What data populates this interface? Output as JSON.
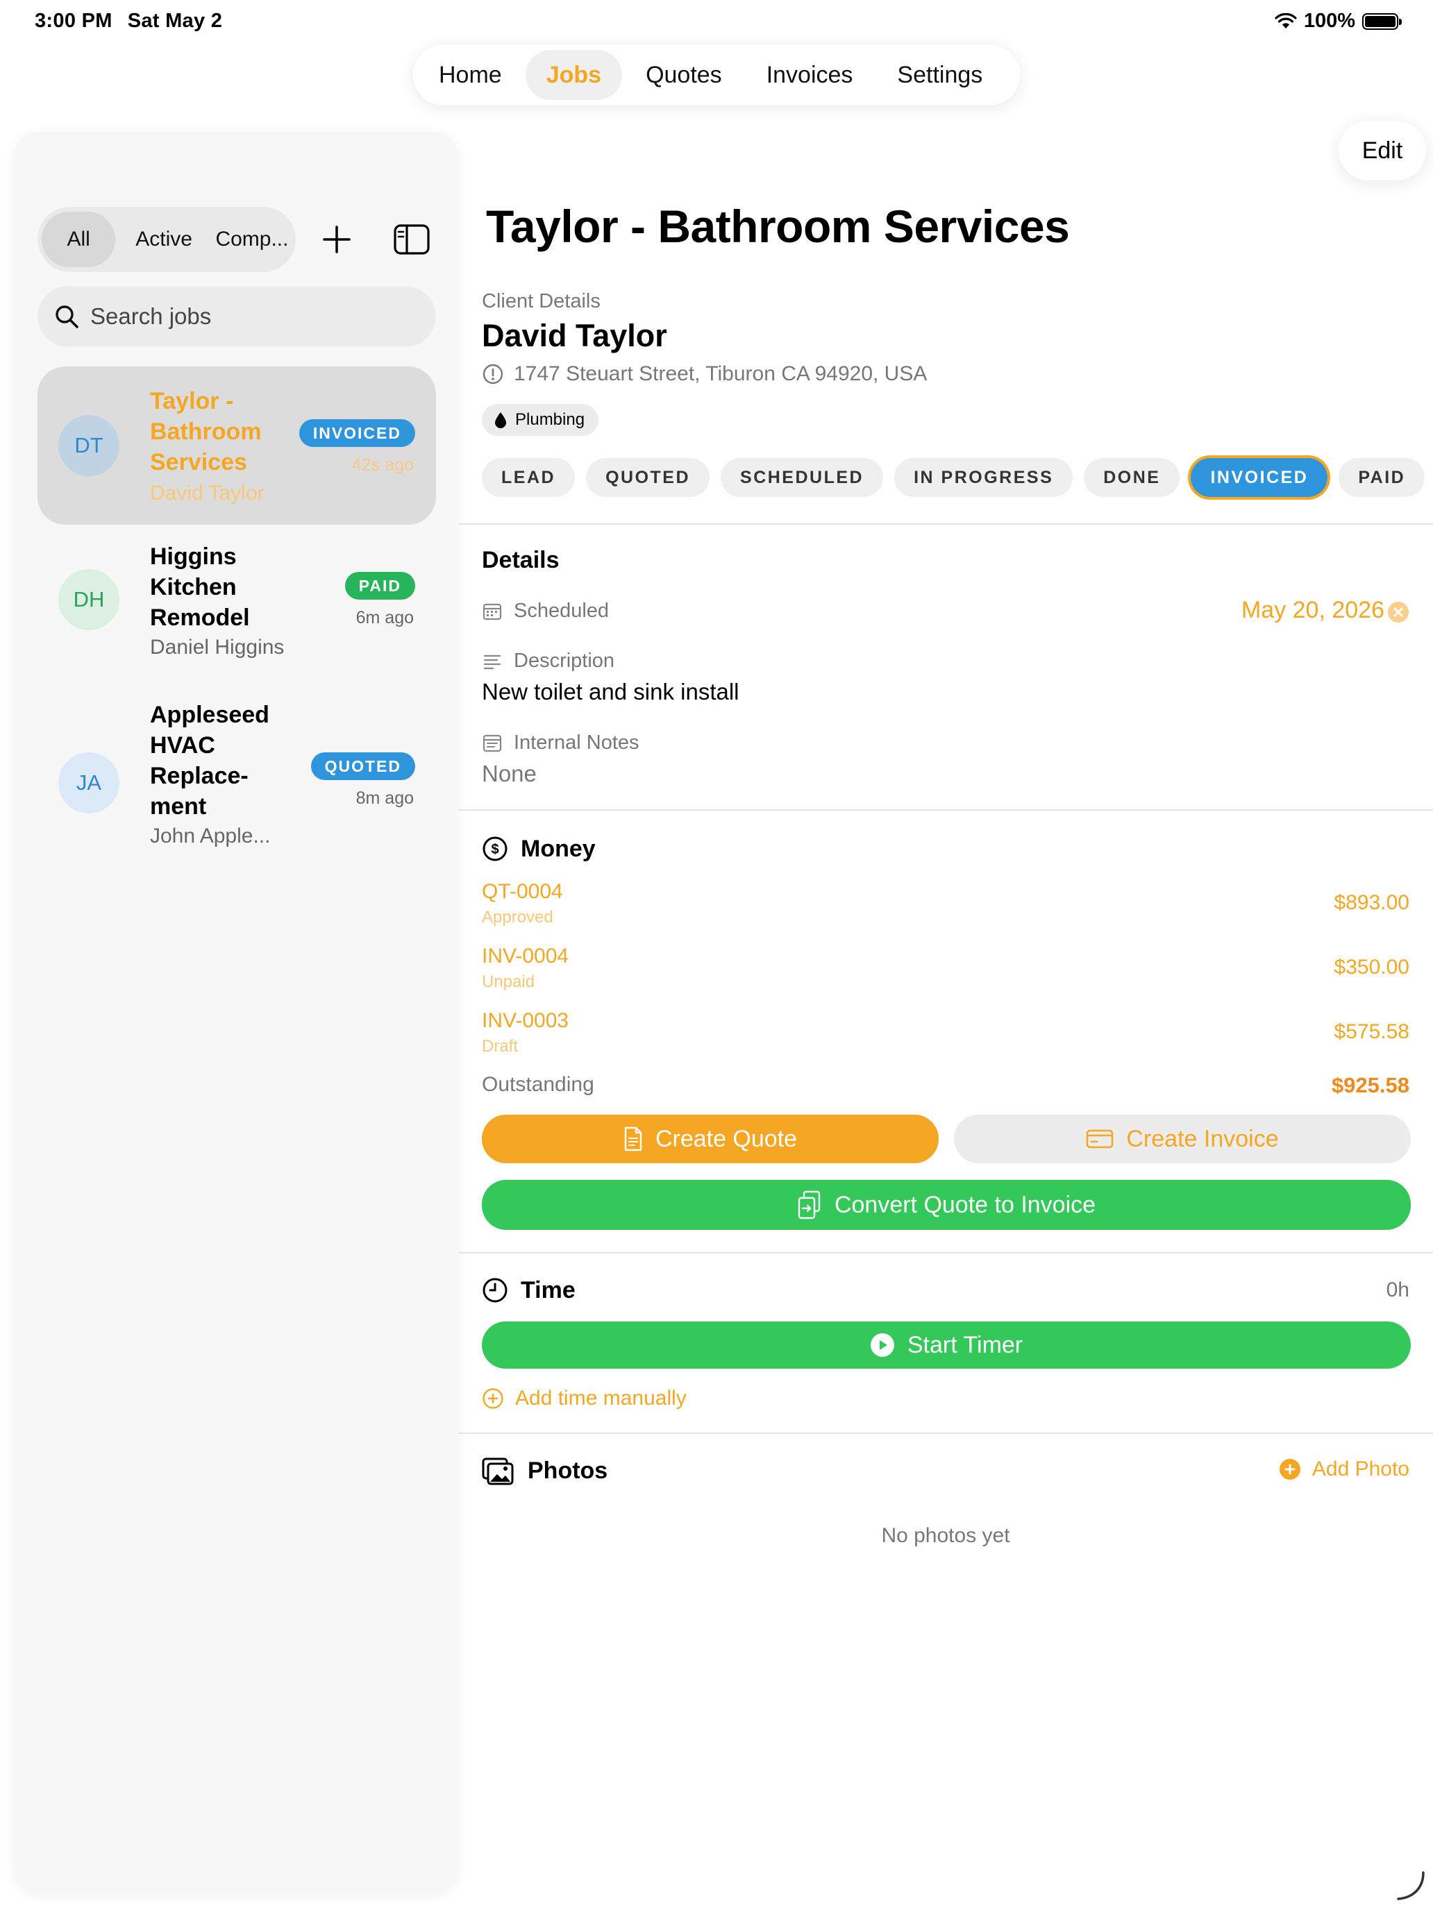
{
  "status_bar": {
    "time": "3:00 PM",
    "date": "Sat May 2",
    "battery": "100%"
  },
  "nav": {
    "tabs": [
      "Home",
      "Jobs",
      "Quotes",
      "Invoices",
      "Settings"
    ],
    "active": "Jobs"
  },
  "edit_label": "Edit",
  "sidebar": {
    "filters": [
      "All",
      "Active",
      "Comp..."
    ],
    "search_placeholder": "Search jobs",
    "jobs": [
      {
        "initials": "DT",
        "title": "Taylor - Bathroom Services",
        "client": "David Taylor",
        "status": "INVOICED",
        "time": "42s ago"
      },
      {
        "initials": "DH",
        "title": "Higgins Kitchen Remodel",
        "client": "Daniel Higgins",
        "status": "PAID",
        "time": "6m ago"
      },
      {
        "initials": "JA",
        "title": "Appleseed HVAC Replace-ment",
        "client": "John Apple...",
        "status": "QUOTED",
        "time": "8m ago"
      }
    ]
  },
  "job": {
    "title": "Taylor - Bathroom Services",
    "client_label": "Client Details",
    "client_name": "David Taylor",
    "address": "1747 Steuart Street, Tiburon CA 94920, USA",
    "tag": "Plumbing",
    "stages": [
      "LEAD",
      "QUOTED",
      "SCHEDULED",
      "IN PROGRESS",
      "DONE",
      "INVOICED",
      "PAID"
    ],
    "current_stage": "INVOICED"
  },
  "details": {
    "title": "Details",
    "scheduled_label": "Scheduled",
    "scheduled_value": "May 20, 2026",
    "description_label": "Description",
    "description_value": "New toilet and sink install",
    "notes_label": "Internal Notes",
    "notes_value": "None"
  },
  "money": {
    "title": "Money",
    "items": [
      {
        "id": "QT-0004",
        "status": "Approved",
        "amount": "$893.00"
      },
      {
        "id": "INV-0004",
        "status": "Unpaid",
        "amount": "$350.00"
      },
      {
        "id": "INV-0003",
        "status": "Draft",
        "amount": "$575.58"
      }
    ],
    "outstanding_label": "Outstanding",
    "outstanding_value": "$925.58",
    "create_quote": "Create Quote",
    "create_invoice": "Create Invoice",
    "convert": "Convert Quote to Invoice"
  },
  "time": {
    "title": "Time",
    "total": "0h",
    "start_timer": "Start Timer",
    "add_manual": "Add time manually"
  },
  "photos": {
    "title": "Photos",
    "add": "Add Photo",
    "empty": "No photos yet"
  },
  "colors": {
    "accent": "#f5a623",
    "invoiced": "#2e95dd",
    "paid": "#28b45a",
    "quoted": "#2e95dd",
    "green_button": "#34c759"
  }
}
